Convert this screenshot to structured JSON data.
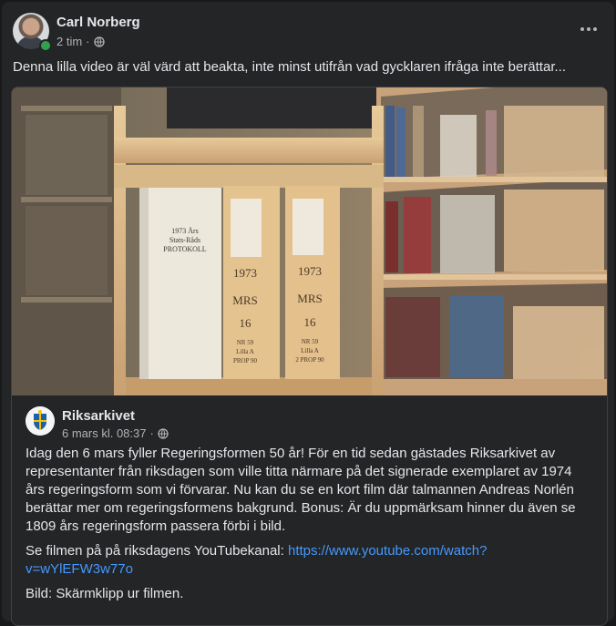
{
  "post": {
    "author": "Carl Norberg",
    "time": "2 tim",
    "sep": "·",
    "privacy_icon": "globe-icon",
    "more_icon": "more-horizontal-icon",
    "text": "Denna lilla video är väl värd att beakta, inte minst utifrån vad gycklaren ifråga inte berättar..."
  },
  "shared": {
    "author": "Riksarkivet",
    "time": "6 mars kl. 08:37",
    "sep": "·",
    "privacy_icon": "globe-icon",
    "paragraph1": "Idag den 6 mars fyller Regeringsformen 50 år! För en tid sedan gästades Riksarkivet av representanter från riksdagen som ville titta närmare på det signerade exemplaret av 1974 års regeringsform som vi förvarar. Nu kan du se en kort film där talmannen Andreas Norlén berättar mer om regeringsformens bakgrund. Bonus: Är du uppmärksam hinner du även se 1809 års regeringsform passera förbi i bild.",
    "paragraph2_prefix": "Se filmen på på riksdagens YouTubekanal: ",
    "paragraph2_link": "https://www.youtube.com/watch?v=wYlEFW3w77o",
    "paragraph3": "Bild: Skärmklipp ur filmen.",
    "image": {
      "volume1_lines": [
        "1973 Års",
        "Stats-Råds",
        "PROTOKOLL"
      ],
      "volume2_lines": [
        "1973",
        "MRS",
        "16",
        "NR 59",
        "Lilla A",
        "PROP 90"
      ],
      "volume3_lines": [
        "1973",
        "MRS",
        "16",
        "NR 59",
        "Lilla A",
        "2 PROP 90"
      ]
    }
  },
  "colors": {
    "background": "#18191a",
    "card": "#242526",
    "text_primary": "#e4e6eb",
    "text_secondary": "#b0b3b8",
    "link": "#4599ff",
    "online": "#31a24c"
  }
}
